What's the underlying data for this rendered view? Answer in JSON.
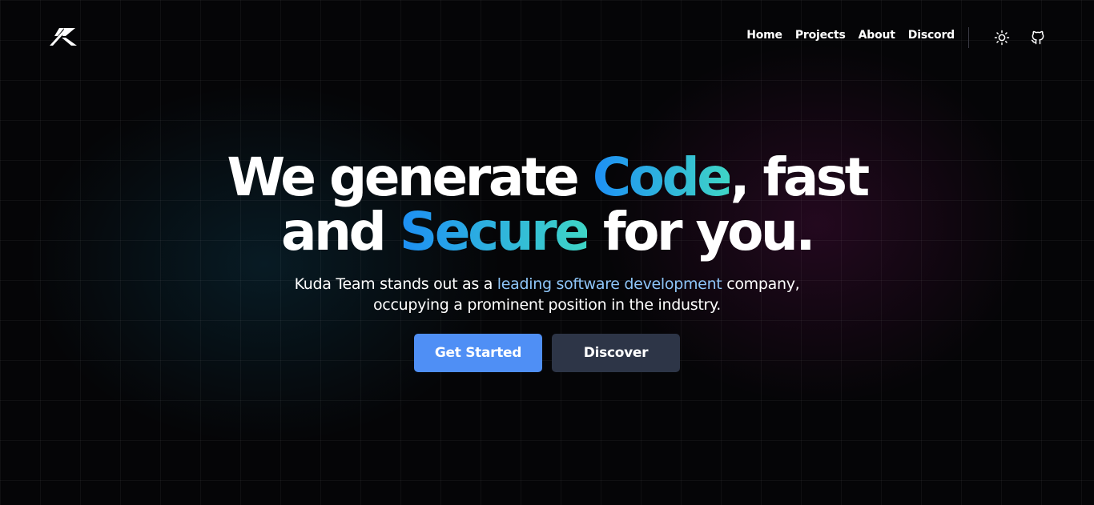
{
  "header": {
    "logo": "kuda-logo",
    "nav": [
      {
        "label": "Home"
      },
      {
        "label": "Projects"
      },
      {
        "label": "About"
      },
      {
        "label": "Discord"
      }
    ],
    "icons": [
      "sun-icon",
      "github-icon"
    ]
  },
  "hero": {
    "title": {
      "line1_a": "We generate ",
      "line1_b": "Code",
      "line1_c": ", fast",
      "line2_a": "and ",
      "line2_b": "Secure",
      "line2_c": " for you."
    },
    "subtitle": {
      "a": "Kuda Team stands out as a ",
      "highlight": "leading software development",
      "b": " company,",
      "line2": "occupying a prominent position in the industry."
    },
    "buttons": {
      "primary": "Get Started",
      "secondary": "Discover"
    }
  },
  "colors": {
    "background": "#050507",
    "accent_gradient_start": "#1d8ff5",
    "accent_gradient_end": "#3fd5c6",
    "highlight_text": "#8ec5f8",
    "primary_button": "#4f8ff5",
    "secondary_button": "#2d3547"
  }
}
